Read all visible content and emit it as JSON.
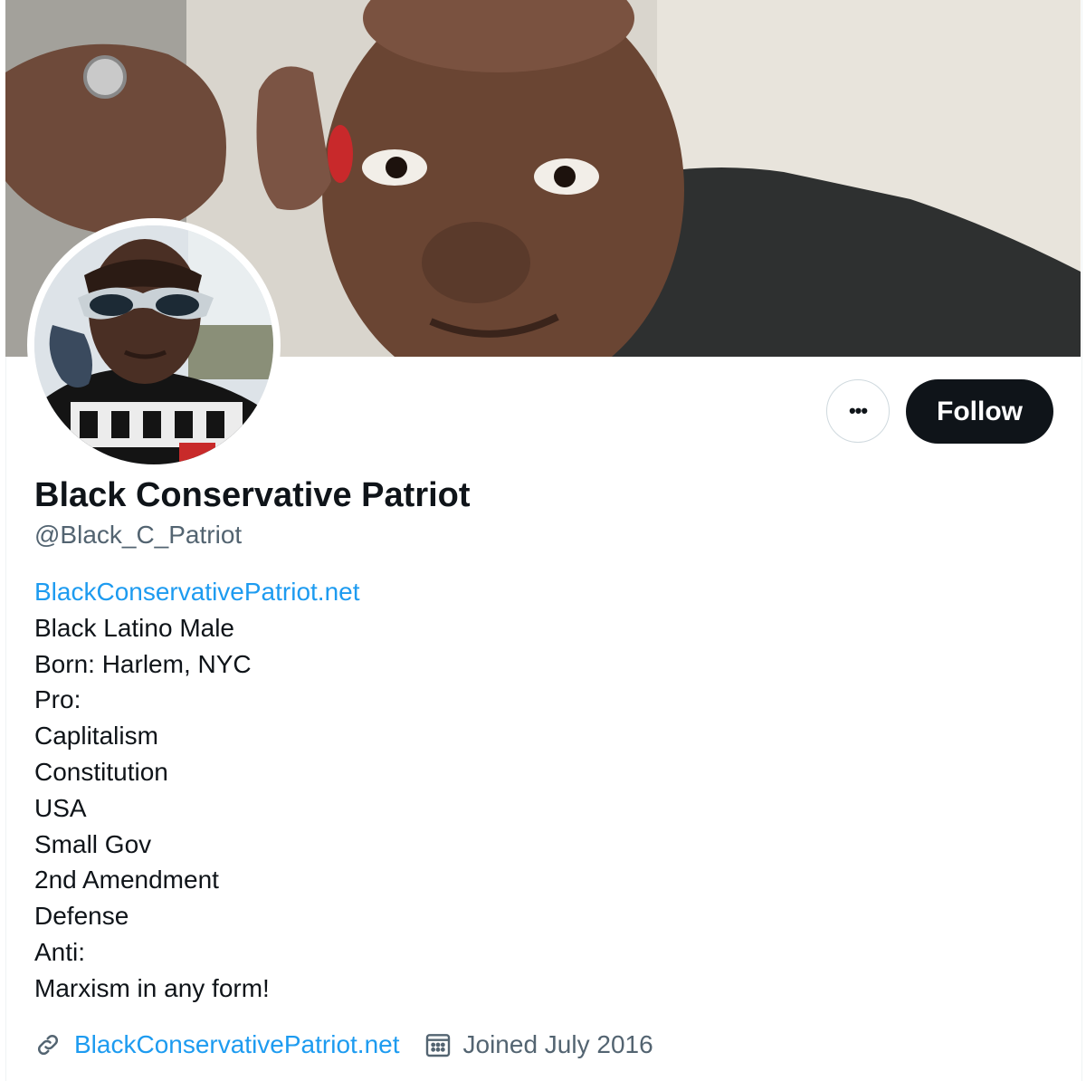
{
  "profile": {
    "display_name": "Black Conservative Patriot",
    "handle": "@Black_C_Patriot",
    "follow_label": "Follow",
    "more_label": "•••"
  },
  "bio": {
    "link": "BlackConservativePatriot.net",
    "lines": [
      "Black Latino Male",
      "Born: Harlem, NYC",
      "Pro:",
      "Caplitalism",
      "Constitution",
      "USA",
      "Small Gov",
      "2nd Amendment",
      "Defense",
      "Anti:",
      "Marxism in any form!"
    ]
  },
  "meta": {
    "website": "BlackConservativePatriot.net",
    "joined": "Joined July 2016",
    "link_icon": "link-icon",
    "calendar_icon": "calendar-icon"
  },
  "colors": {
    "link": "#1d9bf0",
    "secondary_text": "#536471",
    "follow_bg": "#0f1419"
  }
}
